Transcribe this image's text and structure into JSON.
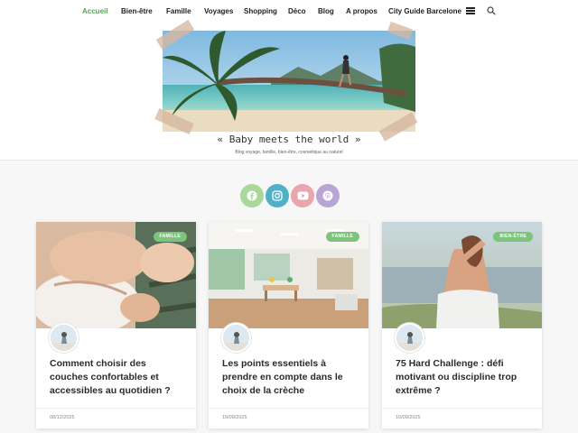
{
  "nav": {
    "items": [
      {
        "label": "Accueil",
        "active": true
      },
      {
        "label": "Bien-être"
      },
      {
        "label": "Famille"
      },
      {
        "label": "Voyages"
      },
      {
        "label": "Shopping"
      },
      {
        "label": "Déco"
      },
      {
        "label": "Blog"
      },
      {
        "label": "A propos"
      },
      {
        "label": "City Guide Barcelone"
      }
    ],
    "icons": [
      "hamburger-menu-icon",
      "search-icon"
    ]
  },
  "header": {
    "site_title": "« Baby meets the world »",
    "tagline": "Blog voyage, famille, bien-être, cosmétique au naturel"
  },
  "social": [
    {
      "name": "facebook",
      "color": "#a8d89a"
    },
    {
      "name": "instagram",
      "color": "#4fb0c6"
    },
    {
      "name": "youtube",
      "color": "#e9a6ad"
    },
    {
      "name": "pinterest",
      "color": "#b9a4d8"
    }
  ],
  "posts": [
    {
      "category": "FAMILLE",
      "title": "Comment choisir des couches confortables et accessibles au quotidien ?",
      "date": "08/12/2025"
    },
    {
      "category": "FAMILLE",
      "title": "Les points essentiels à prendre en compte dans le choix de la crèche",
      "date": "19/09/2025"
    },
    {
      "category": "BIEN-ÊTRE",
      "title": "75 Hard Challenge : défi motivant ou discipline trop extrême ?",
      "date": "10/09/2025"
    }
  ],
  "colors": {
    "accent": "#5aa35a",
    "badge": "#7cc47c"
  }
}
